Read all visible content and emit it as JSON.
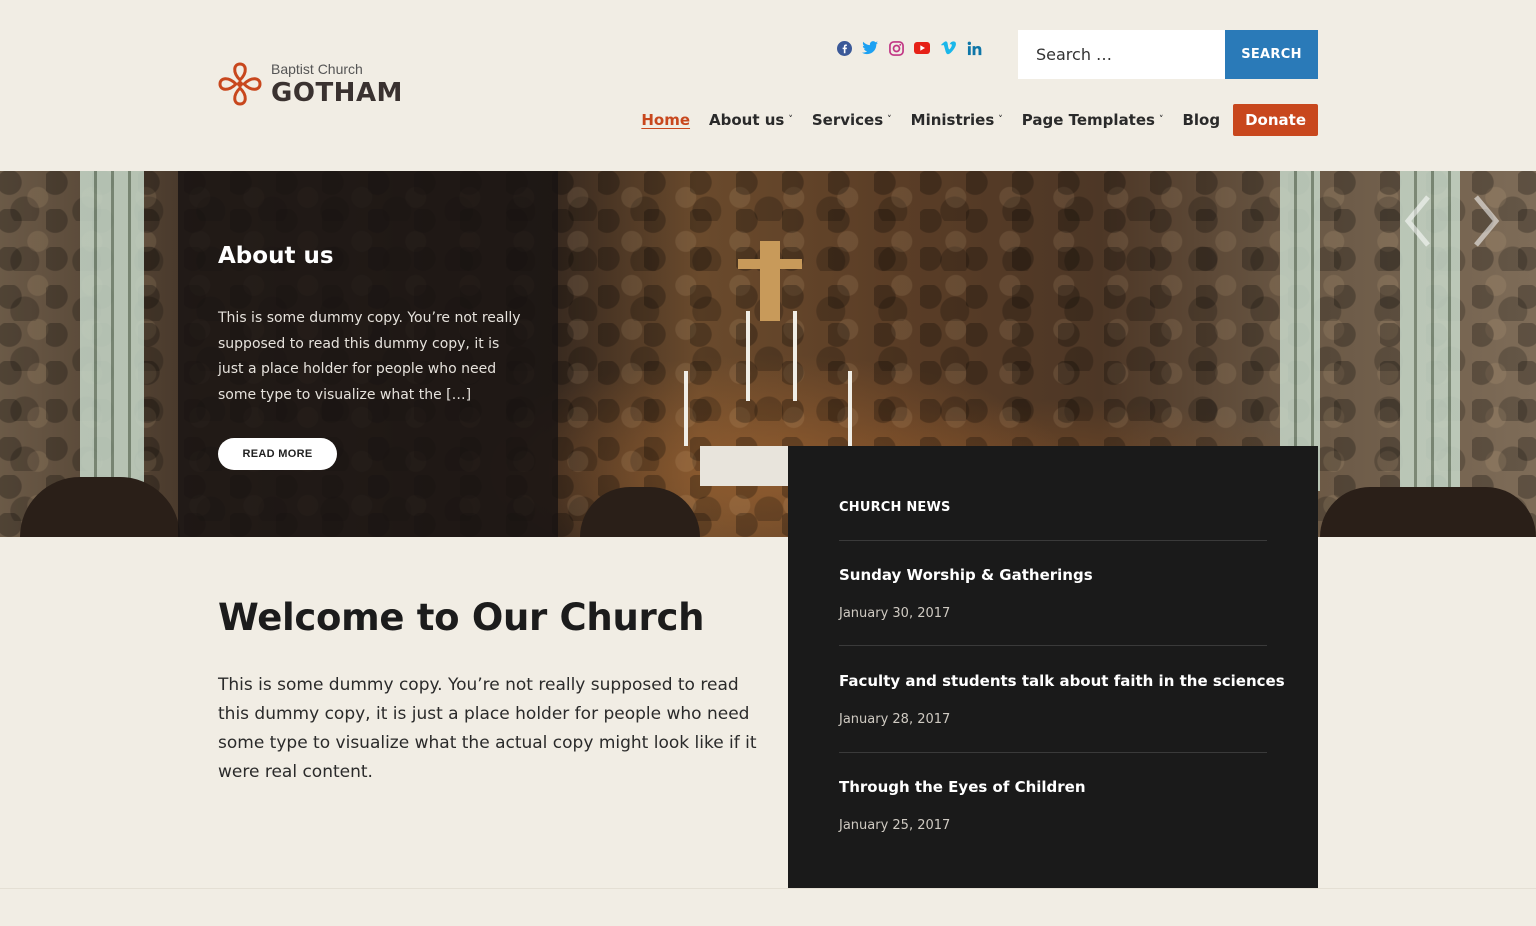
{
  "brand": {
    "subtitle": "Baptist Church",
    "name": "GOTHAM",
    "accent": "#c8471d"
  },
  "social": [
    {
      "icon": "facebook-icon",
      "color": "#3b5998"
    },
    {
      "icon": "twitter-icon",
      "color": "#1da1f2"
    },
    {
      "icon": "instagram-icon",
      "color": "#c13584"
    },
    {
      "icon": "youtube-icon",
      "color": "#e62117"
    },
    {
      "icon": "vimeo-icon",
      "color": "#1ab7ea"
    },
    {
      "icon": "linkedin-icon",
      "color": "#0e76a8"
    }
  ],
  "search": {
    "placeholder": "Search …",
    "button_label": "SEARCH",
    "button_color": "#2a7ab8"
  },
  "nav": {
    "items": [
      {
        "label": "Home",
        "active": true
      },
      {
        "label": "About us",
        "dropdown": true
      },
      {
        "label": "Services",
        "dropdown": true
      },
      {
        "label": "Ministries",
        "dropdown": true
      },
      {
        "label": "Page Templates",
        "dropdown": true
      },
      {
        "label": "Blog"
      }
    ],
    "donate_label": "Donate",
    "caret": "˅"
  },
  "hero": {
    "about_title": "About us",
    "about_text": "This is some dummy copy. You’re not really supposed to read this dummy copy, it is just a place holder for people who need some type to visualize what the […]",
    "read_more_label": "READ MORE",
    "prev_icon": "chevron-left-icon",
    "next_icon": "chevron-right-icon"
  },
  "welcome": {
    "title": "Welcome to Our Church",
    "text": "This is some dummy copy. You’re not really supposed to read this dummy copy, it is just a place holder for people who need some type to visualize what the actual copy might look like if it were real content."
  },
  "news": {
    "heading": "CHURCH NEWS",
    "items": [
      {
        "title": "Sunday Worship & Gatherings",
        "date": "January 30, 2017"
      },
      {
        "title": "Faculty and students talk about faith in the sciences",
        "date": "January 28, 2017"
      },
      {
        "title": "Through the Eyes of Children",
        "date": "January 25, 2017"
      }
    ]
  }
}
